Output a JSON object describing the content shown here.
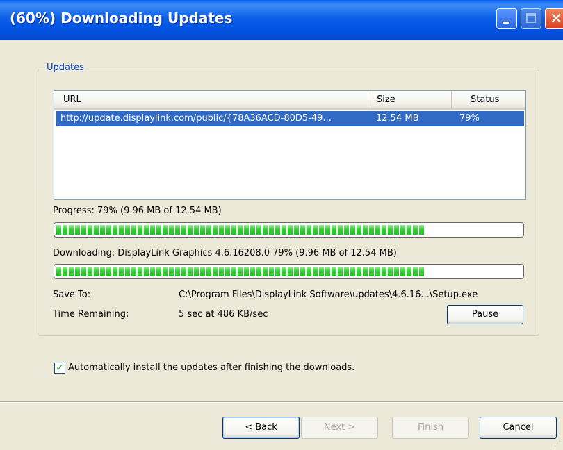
{
  "window": {
    "title": "(60%) Downloading Updates"
  },
  "group": {
    "legend": "Updates"
  },
  "listview": {
    "columns": [
      "URL",
      "Size",
      "Status"
    ],
    "rows": [
      {
        "url": "http://update.displaylink.com/public/{78A36ACD-80D5-49...",
        "size": "12.54 MB",
        "status": "79%"
      }
    ]
  },
  "progress": {
    "overall_label": "Progress: 79% (9.96 MB of 12.54 MB)",
    "overall_fraction": 0.79,
    "item_label": "Downloading: DisplayLink Graphics 4.6.16208.0 79% (9.96 MB of 12.54 MB)",
    "item_fraction": 0.79
  },
  "details": {
    "save_to_label": "Save To:",
    "save_to_value": "C:\\Program Files\\DisplayLink Software\\updates\\4.6.16...\\Setup.exe",
    "time_label": "Time Remaining:",
    "time_value": "5 sec at 486 KB/sec",
    "pause_label": "Pause"
  },
  "options": {
    "auto_install_label": "Automatically install the updates after finishing the downloads.",
    "auto_install_checked": true
  },
  "buttons": {
    "back": "< Back",
    "next": "Next >",
    "finish": "Finish",
    "cancel": "Cancel"
  },
  "colors": {
    "title_bar": "#0052e0",
    "selection": "#316ac5",
    "progress_fill": "#2ecc2e"
  }
}
